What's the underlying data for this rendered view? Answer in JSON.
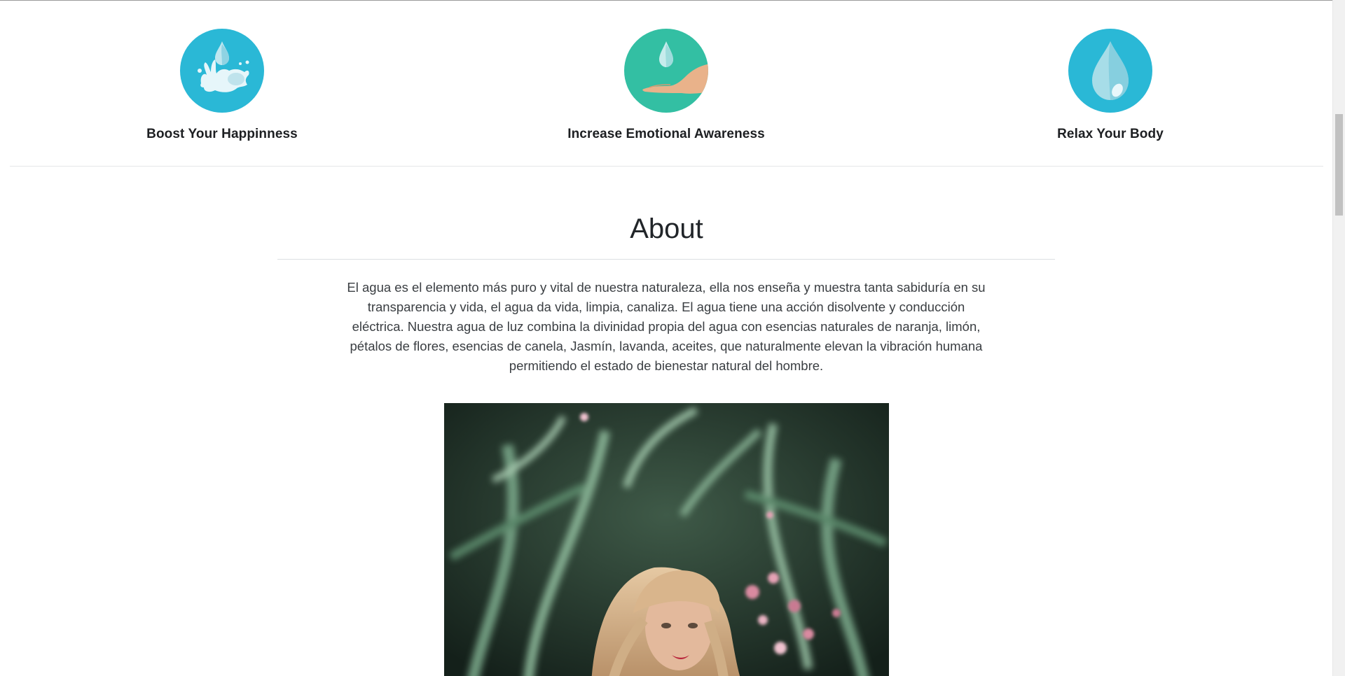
{
  "features": [
    {
      "title": "Boost Your Happinness",
      "icon": "water-splash-icon",
      "color": "#2ab8d6"
    },
    {
      "title": "Increase Emotional Awareness",
      "icon": "hand-drop-icon",
      "color": "#33bfa3"
    },
    {
      "title": "Relax Your Body",
      "icon": "water-drop-icon",
      "color": "#2ab8d6"
    }
  ],
  "about": {
    "heading": "About",
    "body": "El agua es el elemento más puro y vital de nuestra naturaleza, ella nos enseña y muestra tanta sabiduría en su transparencia y vida, el agua da vida, limpia, canaliza. El agua tiene una acción disolvente y conducción eléctrica. Nuestra agua de luz combina la divinidad propia del agua con esencias naturales de naranja, limón, pétalos de flores, esencias de canela, Jasmín, lavanda, aceites, que naturalmente elevan la vibración humana permitiendo el estado de bienestar natural del hombre."
  },
  "colors": {
    "accent_blue": "#2ab8d6",
    "accent_teal": "#33bfa3",
    "text_dark": "#212529"
  }
}
